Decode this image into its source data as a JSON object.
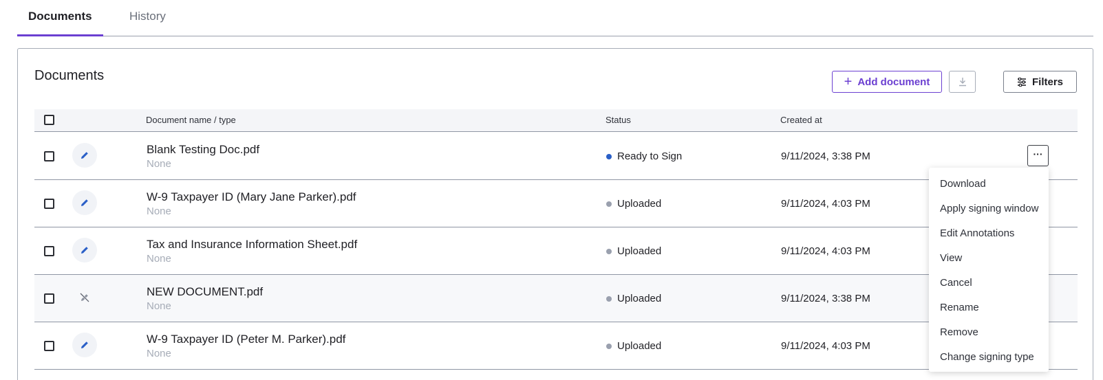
{
  "tabs": [
    {
      "label": "Documents",
      "active": true
    },
    {
      "label": "History",
      "active": false
    }
  ],
  "card": {
    "title": "Documents",
    "add_button_label": "Add document",
    "filters_button_label": "Filters"
  },
  "table": {
    "columns": {
      "name": "Document name / type",
      "status": "Status",
      "created": "Created at"
    },
    "rows": [
      {
        "name": "Blank Testing Doc.pdf",
        "type": "None",
        "status": "Ready to Sign",
        "created": "9/11/2024, 3:38 PM",
        "editable": true
      },
      {
        "name": "W-9 Taxpayer ID (Mary Jane Parker).pdf",
        "type": "None",
        "status": "Uploaded",
        "created": "9/11/2024, 4:03 PM",
        "editable": true
      },
      {
        "name": "Tax and Insurance Information Sheet.pdf",
        "type": "None",
        "status": "Uploaded",
        "created": "9/11/2024, 4:03 PM",
        "editable": true
      },
      {
        "name": "NEW DOCUMENT.pdf",
        "type": "None",
        "status": "Uploaded",
        "created": "9/11/2024, 3:38 PM",
        "editable": false
      },
      {
        "name": "W-9 Taxpayer ID (Peter M. Parker).pdf",
        "type": "None",
        "status": "Uploaded",
        "created": "9/11/2024, 4:03 PM",
        "editable": true
      }
    ]
  },
  "row_menu": {
    "items": [
      "Download",
      "Apply signing window",
      "Edit Annotations",
      "View",
      "Cancel",
      "Rename",
      "Remove",
      "Change signing type"
    ]
  },
  "colors": {
    "accent": "#6b3fd1",
    "edit_icon": "#2a5fc7",
    "status_ready": "#2a5fc7",
    "status_uploaded": "#9aa0ae"
  },
  "icons": {
    "add": "plus-icon",
    "download": "download-icon",
    "filters": "sliders-icon",
    "edit": "pencil-icon",
    "edit_disabled": "pencil-off-icon",
    "more": "more-horizontal-icon"
  }
}
